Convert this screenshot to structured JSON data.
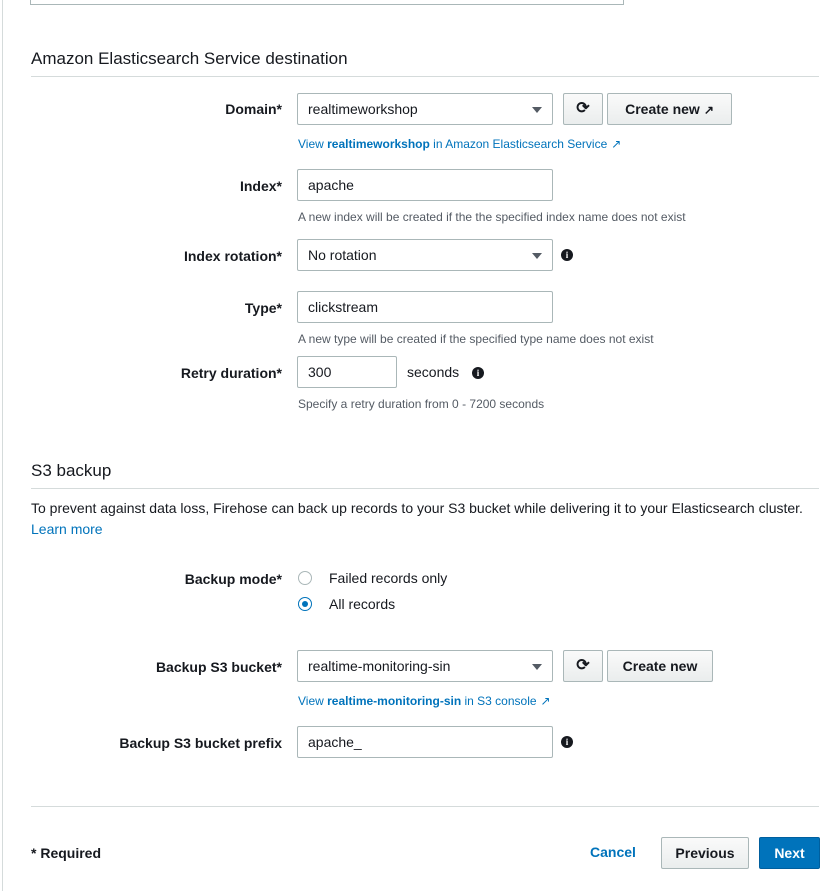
{
  "es": {
    "heading": "Amazon Elasticsearch Service destination",
    "domain": {
      "label": "Domain*",
      "value": "realtimeworkshop",
      "create_new": "Create new",
      "view_prefix": "View ",
      "view_name": "realtimeworkshop",
      "view_suffix": " in Amazon Elasticsearch Service"
    },
    "index": {
      "label": "Index*",
      "value": "apache",
      "hint": "A new index will be created if the the specified index name does not exist"
    },
    "rotation": {
      "label": "Index rotation*",
      "value": "No rotation"
    },
    "type": {
      "label": "Type*",
      "value": "clickstream",
      "hint": "A new type will be created if the specified type name does not exist"
    },
    "retry": {
      "label": "Retry duration*",
      "value": "300",
      "unit": "seconds",
      "hint": "Specify a retry duration from 0 - 7200 seconds"
    }
  },
  "s3": {
    "heading": "S3 backup",
    "description": "To prevent against data loss, Firehose can back up records to your S3 bucket while delivering it to your Elasticsearch cluster.",
    "learn_more": "Learn more",
    "mode": {
      "label": "Backup mode*",
      "options": [
        "Failed records only",
        "All records"
      ],
      "selected": "All records"
    },
    "bucket": {
      "label": "Backup S3 bucket*",
      "value": "realtime-monitoring-sin",
      "create_new": "Create new",
      "view_prefix": "View ",
      "view_name": "realtime-monitoring-sin",
      "view_suffix": " in S3 console"
    },
    "prefix": {
      "label": "Backup S3 bucket prefix",
      "value": "apache_"
    }
  },
  "footer": {
    "required": "* Required",
    "cancel": "Cancel",
    "previous": "Previous",
    "next": "Next"
  },
  "colors": {
    "link": "#0073bb",
    "primary_button": "#0073bb",
    "border": "#aab7b8"
  },
  "icons": {
    "refresh": "refresh-icon",
    "external": "external-link-icon",
    "info": "info-icon",
    "dropdown": "chevron-down-icon"
  }
}
